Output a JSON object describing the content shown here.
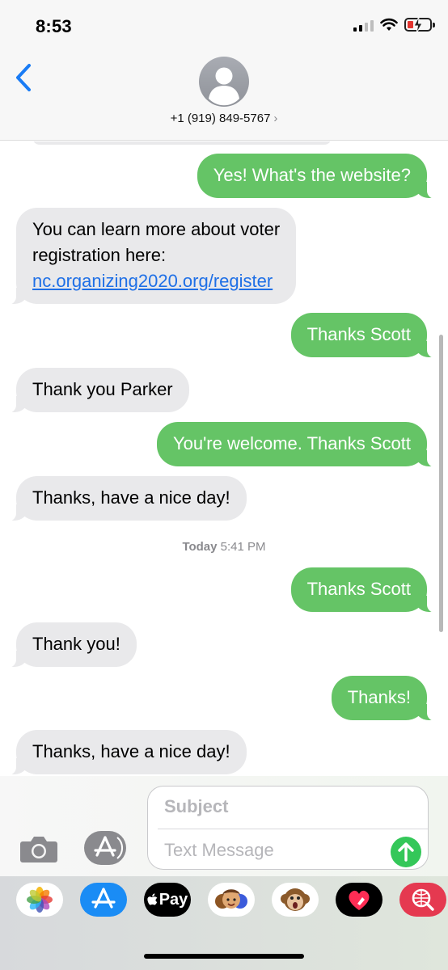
{
  "status_bar": {
    "time": "8:53"
  },
  "header": {
    "contact": "+1 (919) 849-5767",
    "chevron": "›"
  },
  "messages": [
    {
      "direction": "outgoing",
      "text": "Yes! What's the website?"
    },
    {
      "direction": "incoming",
      "line1": "You can learn more about voter",
      "line2": "registration here:",
      "link": "nc.organizing2020.org/register"
    },
    {
      "direction": "outgoing",
      "text": "Thanks Scott"
    },
    {
      "direction": "incoming",
      "text": "Thank you Parker"
    },
    {
      "direction": "outgoing",
      "text": "You're welcome. Thanks Scott"
    },
    {
      "direction": "incoming",
      "text": "Thanks, have a nice day!"
    },
    {
      "direction": "outgoing",
      "text": "Thanks Scott"
    },
    {
      "direction": "incoming",
      "text": "Thank you!"
    },
    {
      "direction": "outgoing",
      "text": "Thanks!"
    },
    {
      "direction": "incoming",
      "text": "Thanks, have a nice day!"
    }
  ],
  "timestamp": {
    "day": "Today",
    "time": "5:41 PM"
  },
  "compose": {
    "subject_placeholder": "Subject",
    "text_placeholder": "Text Message"
  },
  "app_drawer": {
    "apps": [
      "photos-icon",
      "app-store-icon",
      "apple-pay-icon",
      "memoji-icon",
      "animoji-icon",
      "digital-touch-icon",
      "web-images-icon"
    ],
    "apple_pay_label": "Pay"
  },
  "colors": {
    "outgoing_bubble": "#65c466",
    "incoming_bubble": "#e9e9eb",
    "link": "#1e6fe6",
    "accent_blue": "#1a7cf5",
    "send_button": "#34c759"
  }
}
